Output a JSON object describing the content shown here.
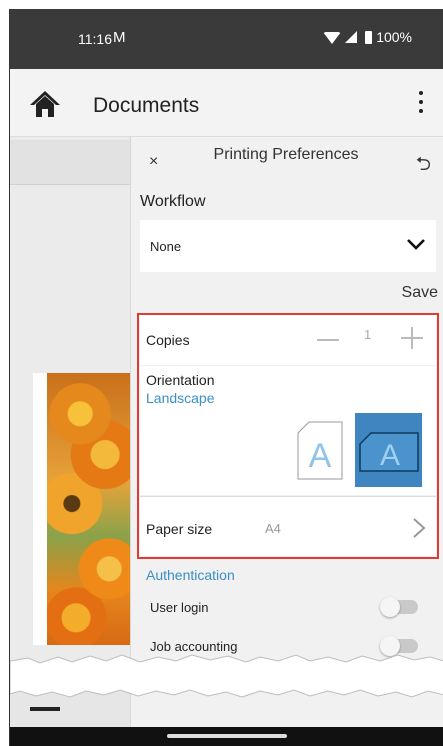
{
  "status_bar": {
    "time": "11:16",
    "mail_icon": "M",
    "battery": "100%"
  },
  "app_bar": {
    "title": "Documents",
    "home_icon": "home-icon",
    "menu_icon": "more-vertical-icon"
  },
  "panel": {
    "title": "Printing Preferences",
    "close_glyph": "×",
    "undo_glyph": "⮌",
    "workflow": {
      "label": "Workflow",
      "value": "None"
    },
    "save_label": "Save",
    "copies": {
      "label": "Copies",
      "value": "1"
    },
    "orientation": {
      "label": "Orientation",
      "value": "Landscape",
      "portrait_letter": "A",
      "landscape_letter": "A"
    },
    "paper_size": {
      "label": "Paper size",
      "value": "A4"
    },
    "authentication": {
      "label": "Authentication",
      "user_login": "User login",
      "job_accounting": "Job accounting"
    }
  },
  "colors": {
    "accent": "#3b8fc4",
    "selected_tile": "#3f86c0",
    "highlight_border": "#e53935"
  }
}
